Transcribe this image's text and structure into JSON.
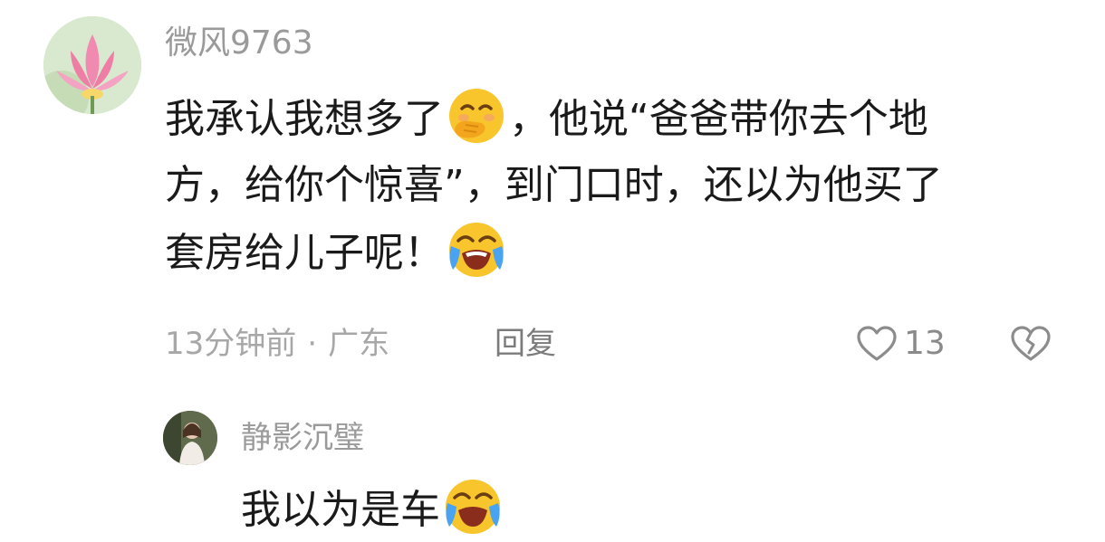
{
  "comment": {
    "username": "微风9763",
    "avatar_icon": "lotus-avatar-icon",
    "lines": [
      {
        "before": "我承认我想多了",
        "emoji": "face-with-hand-over-mouth",
        "after": "，他说“爸爸带你去个地"
      },
      {
        "text": "方，给你个惊喜”，到门口时，还以为他买了"
      },
      {
        "before": "套房给儿子呢！",
        "emoji": "loudly-crying-face"
      }
    ],
    "time": "13分钟前",
    "separator": "·",
    "location": "广东",
    "reply_label": "回复",
    "like_count": "13"
  },
  "reply": {
    "username": "静影沉璧",
    "avatar_icon": "person-photo-avatar-icon",
    "text": "我以为是车",
    "emoji": "loudly-crying-face"
  }
}
